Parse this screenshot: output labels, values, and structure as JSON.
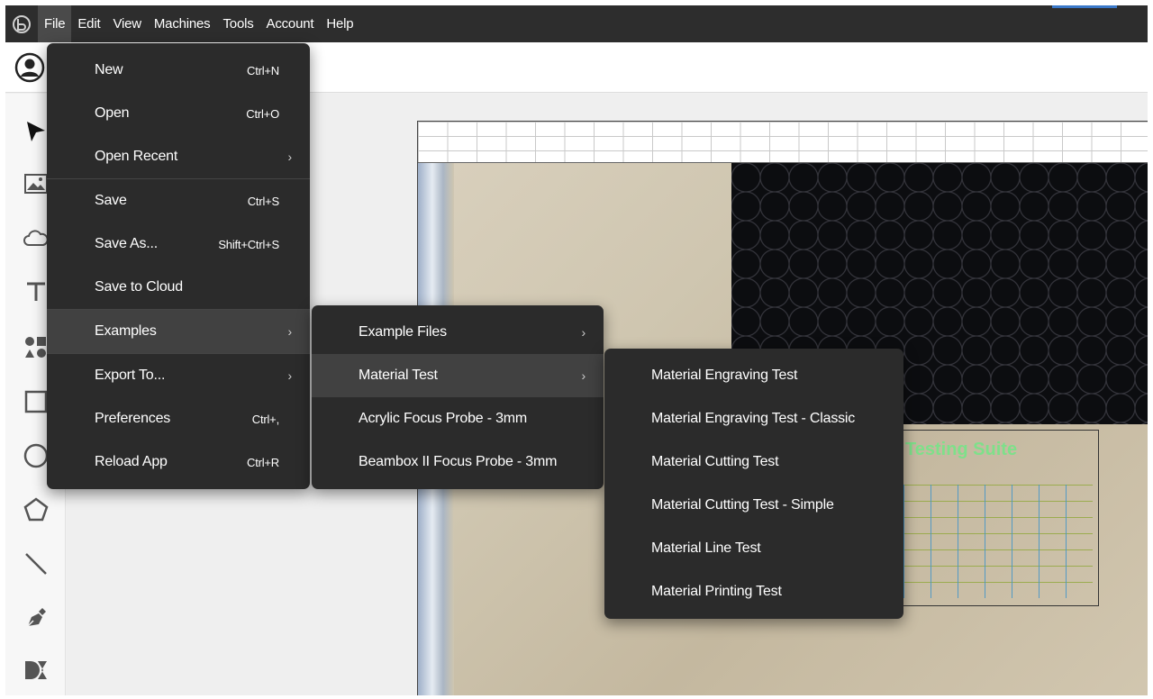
{
  "menubar": {
    "items": [
      "File",
      "Edit",
      "View",
      "Machines",
      "Tools",
      "Account",
      "Help"
    ],
    "active": "File"
  },
  "file_menu": {
    "new": {
      "label": "New",
      "shortcut": "Ctrl+N"
    },
    "open": {
      "label": "Open",
      "shortcut": "Ctrl+O"
    },
    "open_recent": {
      "label": "Open Recent"
    },
    "save": {
      "label": "Save",
      "shortcut": "Ctrl+S"
    },
    "save_as": {
      "label": "Save As...",
      "shortcut": "Shift+Ctrl+S"
    },
    "save_to_cloud": {
      "label": "Save to Cloud"
    },
    "examples": {
      "label": "Examples"
    },
    "export_to": {
      "label": "Export To..."
    },
    "preferences": {
      "label": "Preferences",
      "shortcut": "Ctrl+,"
    },
    "reload_app": {
      "label": "Reload App",
      "shortcut": "Ctrl+R"
    }
  },
  "examples_menu": {
    "items": [
      "Example Files",
      "Material Test",
      "Acrylic Focus Probe - 3mm",
      "Beambox II Focus Probe - 3mm"
    ]
  },
  "material_test_menu": {
    "items": [
      "Material Engraving Test",
      "Material Engraving Test - Classic",
      "Material Cutting Test",
      "Material Cutting Test - Simple",
      "Material Line Test",
      "Material Printing Test"
    ]
  },
  "canvas": {
    "suite_title": "Testing Suite"
  },
  "tools": [
    "pointer-icon",
    "image-icon",
    "cloud-icon",
    "text-icon",
    "elements-icon",
    "rectangle-icon",
    "ellipse-icon",
    "polygon-icon",
    "line-icon",
    "pen-icon",
    "dmkt-icon"
  ],
  "colors": {
    "menubar": "#2d2d2d",
    "menu_bg": "#2b2b2b",
    "menu_highlight": "#414141",
    "suite_green": "#7ee08a"
  }
}
